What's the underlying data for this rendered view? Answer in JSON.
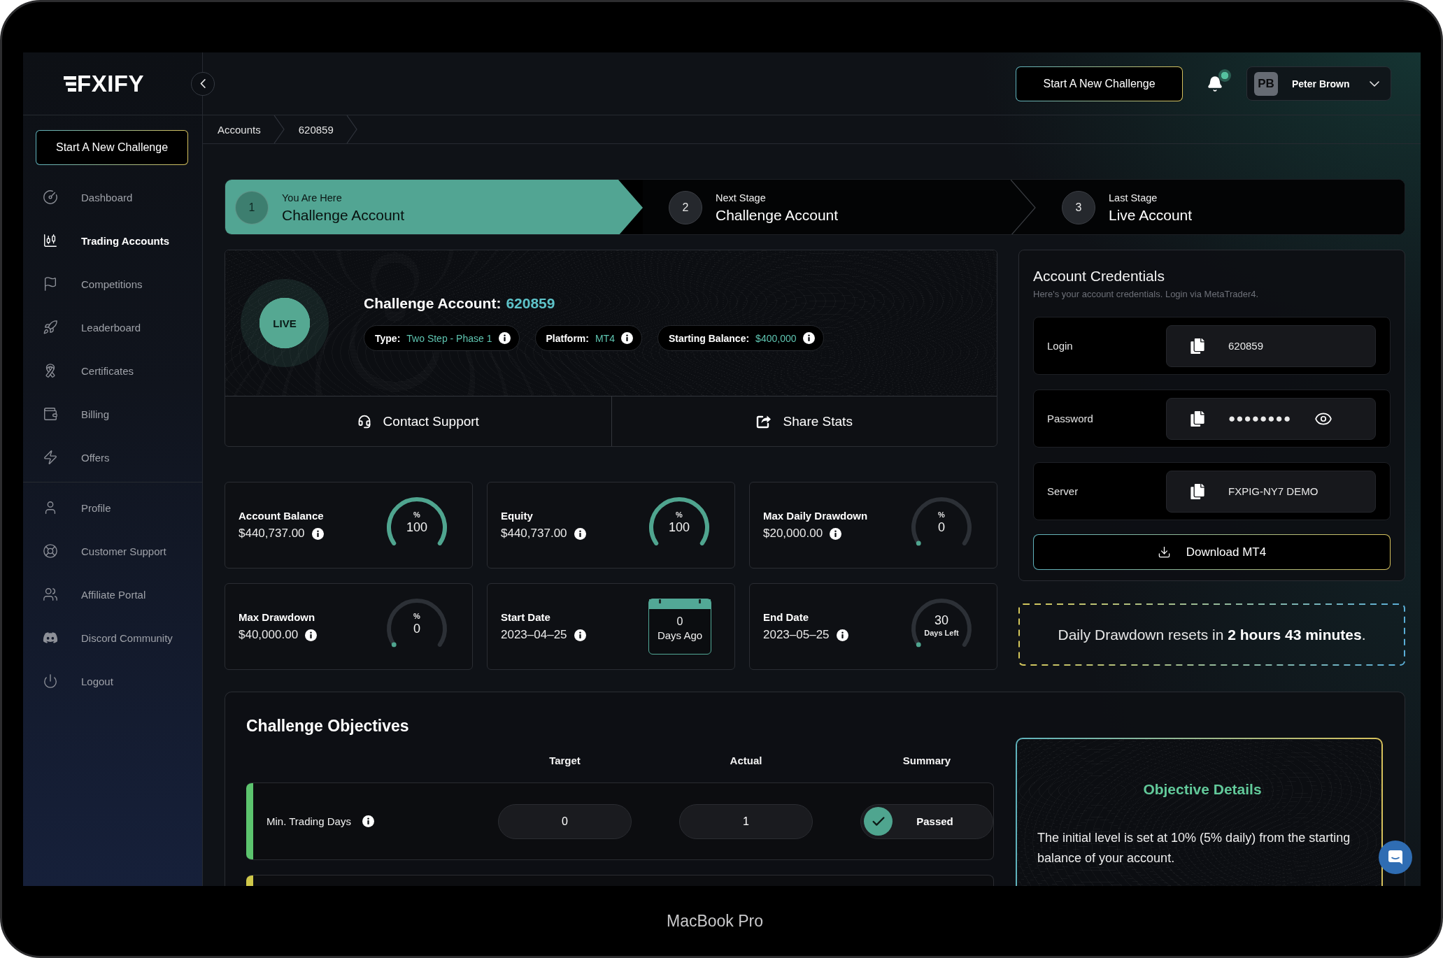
{
  "device": {
    "label": "MacBook Pro"
  },
  "sidebar": {
    "logo": "FXIFY",
    "new_challenge_button": "Start A New Challenge",
    "items": [
      {
        "label": "Dashboard",
        "selected": false
      },
      {
        "label": "Trading Accounts",
        "selected": true
      },
      {
        "label": "Competitions",
        "selected": false
      },
      {
        "label": "Leaderboard",
        "selected": false
      },
      {
        "label": "Certificates",
        "selected": false
      },
      {
        "label": "Billing",
        "selected": false
      },
      {
        "label": "Offers",
        "selected": false
      }
    ],
    "account_items": [
      {
        "label": "Profile",
        "selected": false
      },
      {
        "label": "Customer Support",
        "selected": false
      },
      {
        "label": "Affiliate Portal",
        "selected": false
      },
      {
        "label": "Discord Community",
        "selected": false
      },
      {
        "label": "Logout",
        "selected": false
      }
    ]
  },
  "header": {
    "new_challenge_button": "Start A New Challenge",
    "notifications": {
      "unread": true
    },
    "user": {
      "initials": "PB",
      "name": "Peter Brown"
    }
  },
  "breadcrumb": [
    {
      "label": "Accounts"
    },
    {
      "label": "620859"
    }
  ],
  "stages": [
    {
      "number": "1",
      "caption": "You Are Here",
      "title": "Challenge Account",
      "selected": true
    },
    {
      "number": "2",
      "caption": "Next Stage",
      "title": "Challenge Account",
      "selected": false
    },
    {
      "number": "3",
      "caption": "Last Stage",
      "title": "Live Account",
      "selected": false
    }
  ],
  "account": {
    "status": "LIVE",
    "title": "Challenge Account:",
    "number": "620859",
    "details": [
      {
        "label": "Type:",
        "value": "Two Step - Phase 1"
      },
      {
        "label": "Platform:",
        "value": "MT4"
      },
      {
        "label": "Starting Balance:",
        "value": "$400,000"
      }
    ],
    "actions": [
      {
        "label": "Contact Support"
      },
      {
        "label": "Share Stats"
      }
    ]
  },
  "stats": [
    {
      "label": "Account Balance",
      "value": "$440,737.00",
      "kind": "gauge",
      "unit": "%",
      "reading": "100",
      "level": 1
    },
    {
      "label": "Equity",
      "value": "$440,737.00",
      "kind": "gauge",
      "unit": "%",
      "reading": "100",
      "level": 1
    },
    {
      "label": "Max Daily Drawdown",
      "value": "$20,000.00",
      "kind": "gauge",
      "unit": "%",
      "reading": "0"
    },
    {
      "label": "Max Drawdown",
      "value": "$40,000.00",
      "kind": "gauge",
      "unit": "%",
      "reading": "0"
    },
    {
      "label": "Start Date",
      "value": "2023–04–25",
      "kind": "calendar",
      "reading": "0",
      "caption": "Days Ago"
    },
    {
      "label": "End Date",
      "value": "2023–05–25",
      "kind": "gauge",
      "reading": "30",
      "caption": "Days Left"
    }
  ],
  "credentials": {
    "title": "Account Credentials",
    "subtitle": "Here's your account credentials. Login via MetaTrader4.",
    "fields": [
      {
        "label": "Login",
        "value": "620859",
        "kind": "text"
      },
      {
        "label": "Password",
        "value": "●●●●●●●●",
        "kind": "secret"
      },
      {
        "label": "Server",
        "value": "FXPIG-NY7 DEMO",
        "kind": "text"
      }
    ],
    "download_button": "Download MT4"
  },
  "drawdown_notice": "Daily Drawdown resets in **2 hours 43 minutes**.",
  "objectives": {
    "title": "Challenge Objectives",
    "columns": [
      "Target",
      "Actual",
      "Summary"
    ],
    "rows": [
      {
        "name": "Min. Trading Days",
        "target": "0",
        "actual": "1",
        "summary": "Passed",
        "passed": true,
        "color": "#5cc46e"
      },
      {
        "color": "#cfc84a"
      }
    ],
    "details": {
      "title": "Objective Details",
      "text": "The initial level is set at 10% (5% daily) from the starting balance of your account."
    }
  }
}
